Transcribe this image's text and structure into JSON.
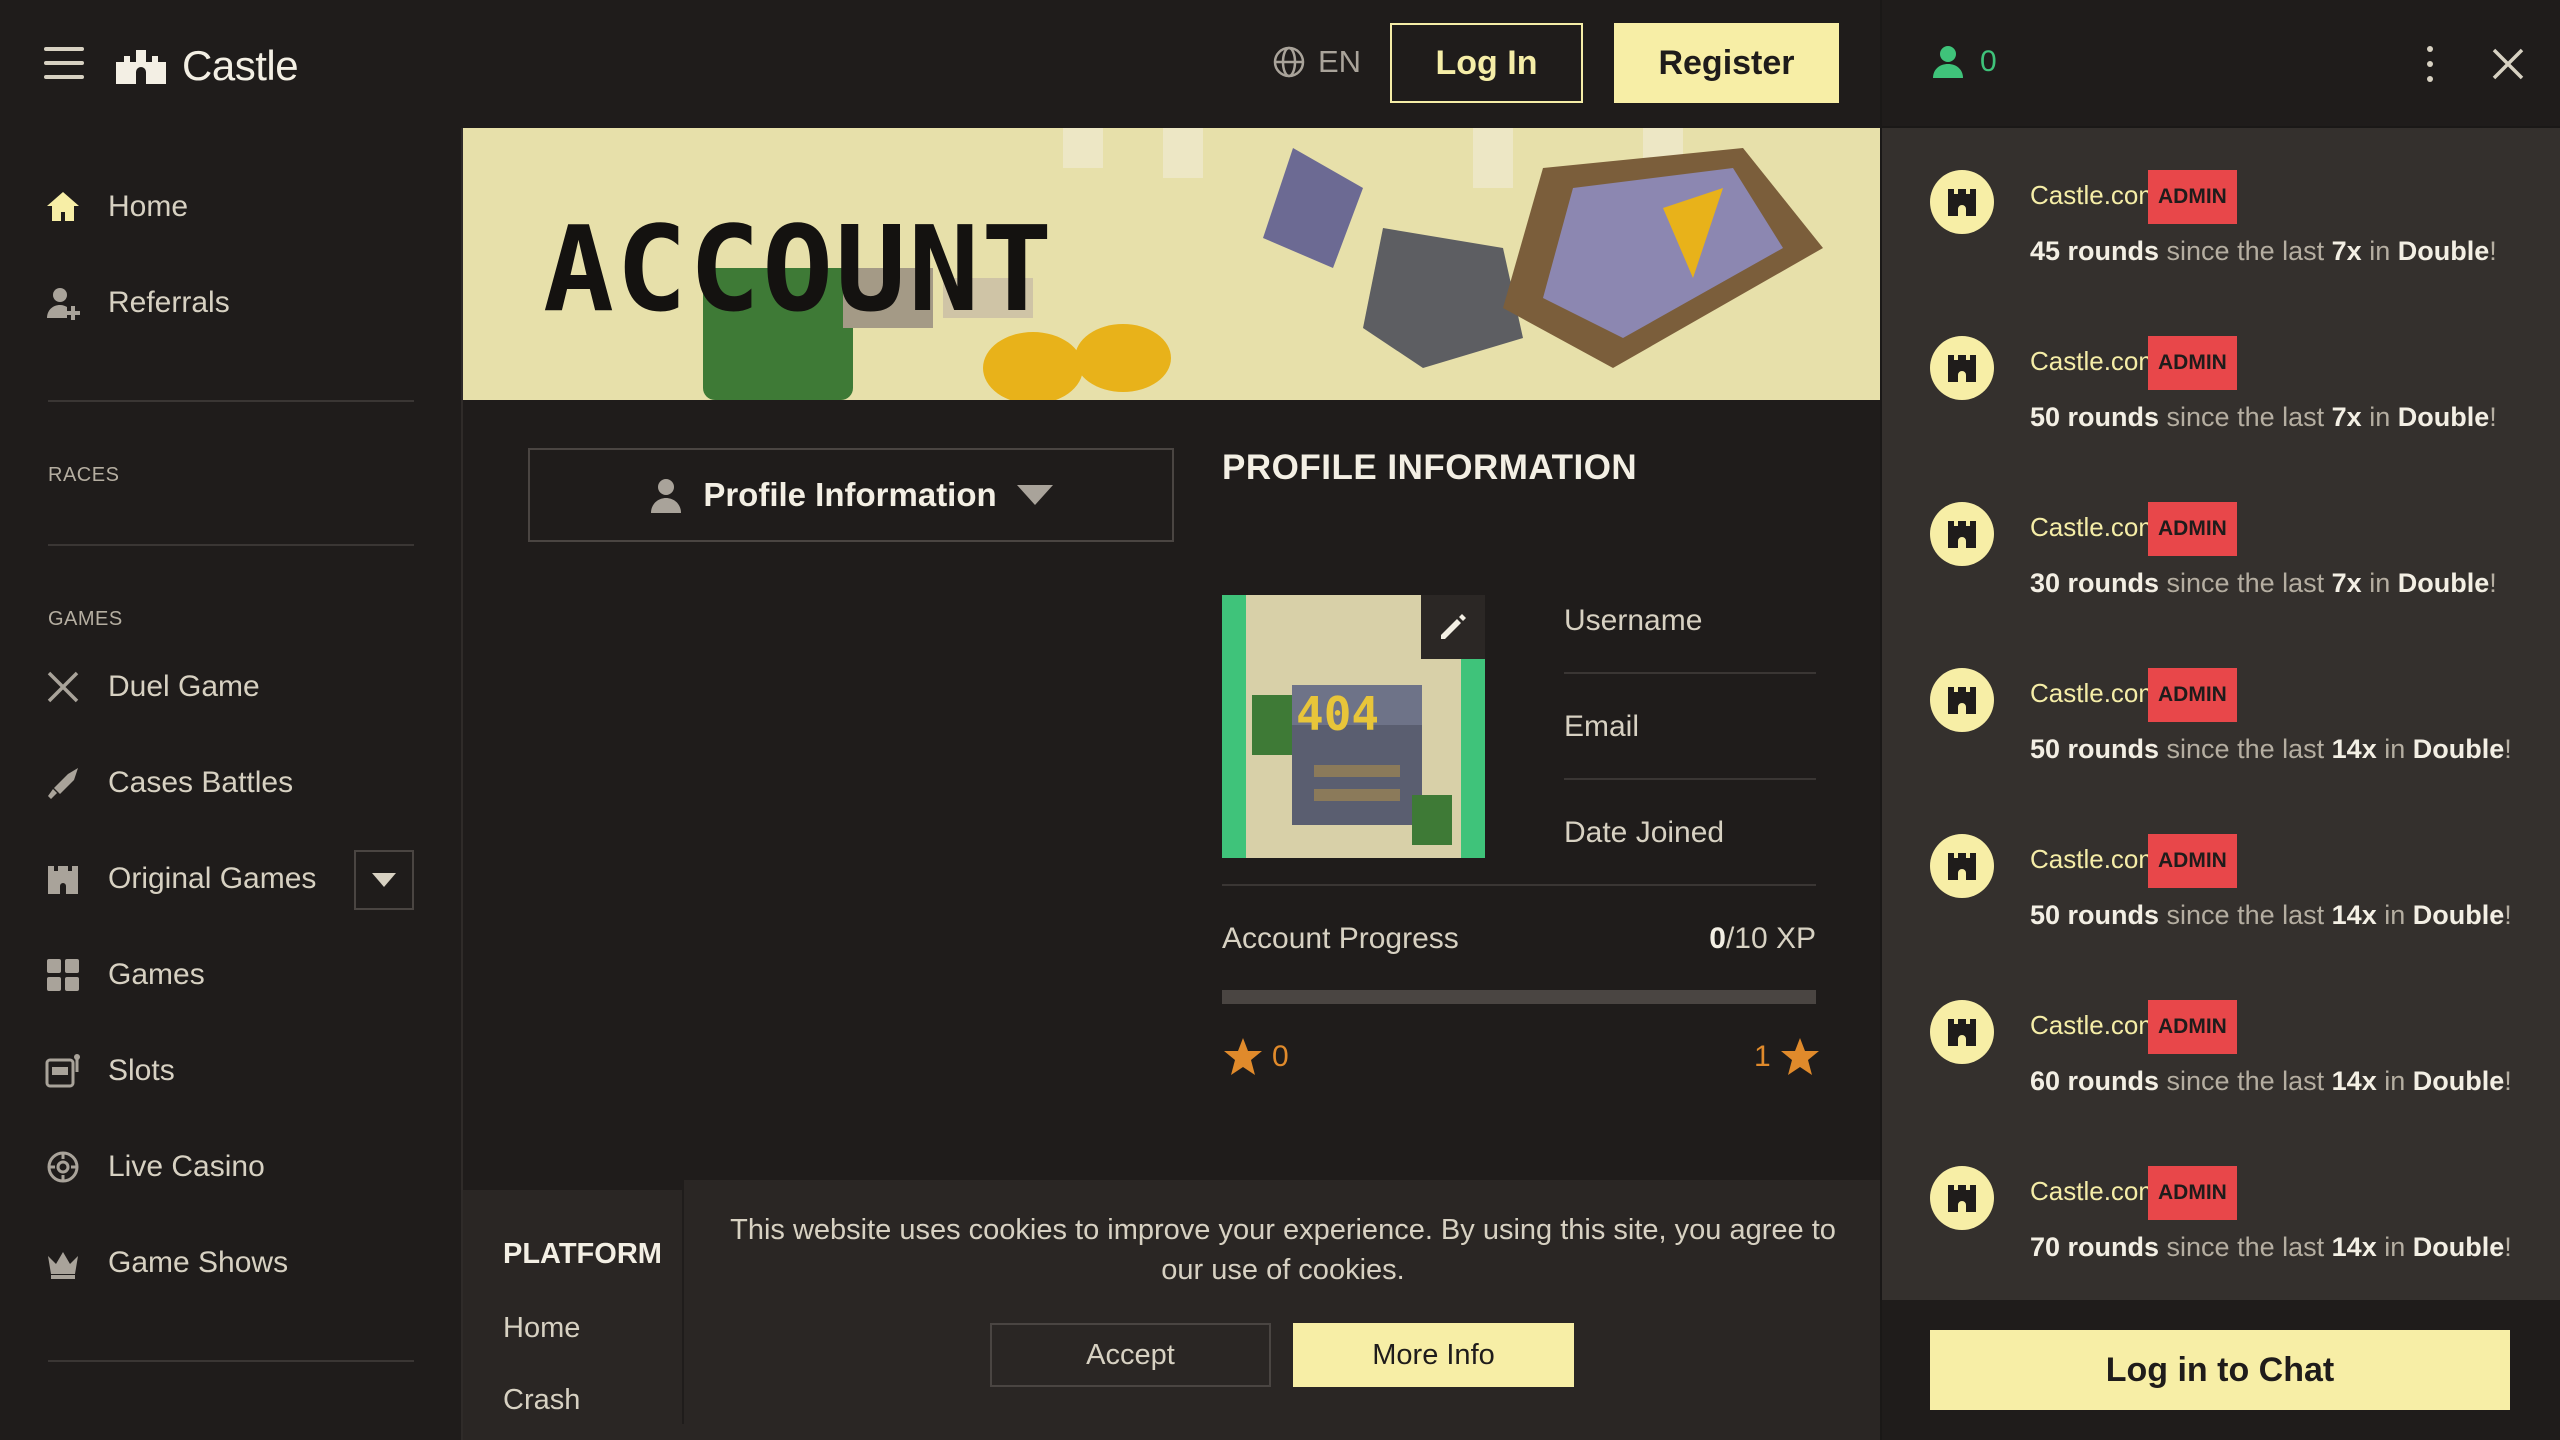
{
  "header": {
    "brand": "Castle",
    "language": "EN",
    "login_label": "Log In",
    "register_label": "Register"
  },
  "sidebar": {
    "items_top": [
      {
        "label": "Home",
        "icon": "home-icon"
      },
      {
        "label": "Referrals",
        "icon": "add-user-icon"
      }
    ],
    "races_label": "RACES",
    "games_label": "GAMES",
    "games": [
      {
        "label": "Duel Game",
        "icon": "crossed-swords-icon"
      },
      {
        "label": "Cases Battles",
        "icon": "sword-icon"
      },
      {
        "label": "Original Games",
        "icon": "castle-icon"
      },
      {
        "label": "Games",
        "icon": "grid-icon"
      },
      {
        "label": "Slots",
        "icon": "slot-machine-icon"
      },
      {
        "label": "Live Casino",
        "icon": "chip-icon"
      },
      {
        "label": "Game Shows",
        "icon": "crown-icon"
      }
    ]
  },
  "banner": {
    "title": "ACCOUNT"
  },
  "profile": {
    "toggle_label": "Profile Information",
    "section_title": "PROFILE INFORMATION",
    "avatar_text": "404",
    "fields": [
      "Username",
      "Email",
      "Date Joined"
    ],
    "progress_label": "Account Progress",
    "progress_current": "0",
    "progress_total": "/10 XP",
    "progress_fraction": 0,
    "level_current": "0",
    "level_next": "1"
  },
  "footer": {
    "heading": "PLATFORM",
    "links": [
      "Home",
      "Crash"
    ]
  },
  "cookie": {
    "text": "This website uses cookies to improve your experience. By using this site, you agree to our use of cookies.",
    "accept_label": "Accept",
    "more_label": "More Info"
  },
  "chat": {
    "online_count": "0",
    "messages": [
      {
        "user": "Castle.com",
        "badge": "ADMIN",
        "count": "45 rounds",
        "mid": "since the last",
        "mult": "7x",
        "in": "in",
        "game": "Double",
        "end": "!"
      },
      {
        "user": "Castle.com",
        "badge": "ADMIN",
        "count": "50 rounds",
        "mid": "since the last",
        "mult": "7x",
        "in": "in",
        "game": "Double",
        "end": "!"
      },
      {
        "user": "Castle.com",
        "badge": "ADMIN",
        "count": "30 rounds",
        "mid": "since the last",
        "mult": "7x",
        "in": "in",
        "game": "Double",
        "end": "!"
      },
      {
        "user": "Castle.com",
        "badge": "ADMIN",
        "count": "50 rounds",
        "mid": "since the last",
        "mult": "14x",
        "in": "in",
        "game": "Double",
        "end": "!"
      },
      {
        "user": "Castle.com",
        "badge": "ADMIN",
        "count": "50 rounds",
        "mid": "since the last",
        "mult": "14x",
        "in": "in",
        "game": "Double",
        "end": "!"
      },
      {
        "user": "Castle.com",
        "badge": "ADMIN",
        "count": "60 rounds",
        "mid": "since the last",
        "mult": "14x",
        "in": "in",
        "game": "Double",
        "end": "!"
      },
      {
        "user": "Castle.com",
        "badge": "ADMIN",
        "count": "70 rounds",
        "mid": "since the last",
        "mult": "14x",
        "in": "in",
        "game": "Double",
        "end": "!"
      }
    ],
    "login_label": "Log in to Chat"
  },
  "colors": {
    "accent": "#f7eea6",
    "background": "#1f1c1b",
    "chat_background": "#34302d",
    "online_green": "#3fc37a",
    "admin_red": "#e8474a",
    "star_orange": "#e08a2b"
  }
}
